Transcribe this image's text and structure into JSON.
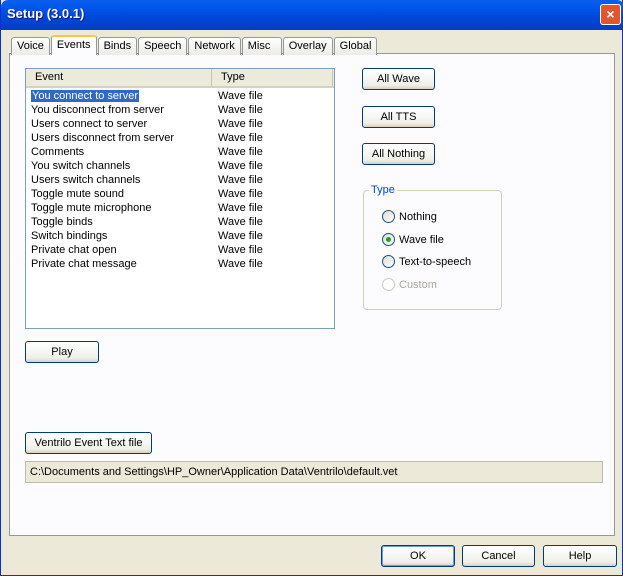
{
  "window": {
    "title": "Setup (3.0.1)",
    "close": "×"
  },
  "tabs": [
    "Voice",
    "Events",
    "Binds",
    "Speech",
    "Network",
    "Misc",
    "Overlay",
    "Global"
  ],
  "list": {
    "headers": [
      "Event",
      "Type"
    ],
    "rows": [
      [
        "You connect to server",
        "Wave file"
      ],
      [
        "You disconnect from server",
        "Wave file"
      ],
      [
        "Users connect to server",
        "Wave file"
      ],
      [
        "Users disconnect from server",
        "Wave file"
      ],
      [
        "Comments",
        "Wave file"
      ],
      [
        "You switch channels",
        "Wave file"
      ],
      [
        "Users switch channels",
        "Wave file"
      ],
      [
        "Toggle mute sound",
        "Wave file"
      ],
      [
        "Toggle mute microphone",
        "Wave file"
      ],
      [
        "Toggle binds",
        "Wave file"
      ],
      [
        "Switch bindings",
        "Wave file"
      ],
      [
        "Private chat open",
        "Wave file"
      ],
      [
        "Private chat message",
        "Wave file"
      ]
    ]
  },
  "buttons": {
    "all_wave": "All Wave",
    "all_tts": "All TTS",
    "all_nothing": "All Nothing",
    "play": "Play",
    "event_text": "Ventrilo Event Text file",
    "ok": "OK",
    "cancel": "Cancel",
    "help": "Help"
  },
  "type_group": {
    "label": "Type",
    "options": [
      "Nothing",
      "Wave file",
      "Text-to-speech",
      "Custom"
    ],
    "selected": "Wave file"
  },
  "path": "C:\\Documents and Settings\\HP_Owner\\Application Data\\Ventrilo\\default.vet"
}
